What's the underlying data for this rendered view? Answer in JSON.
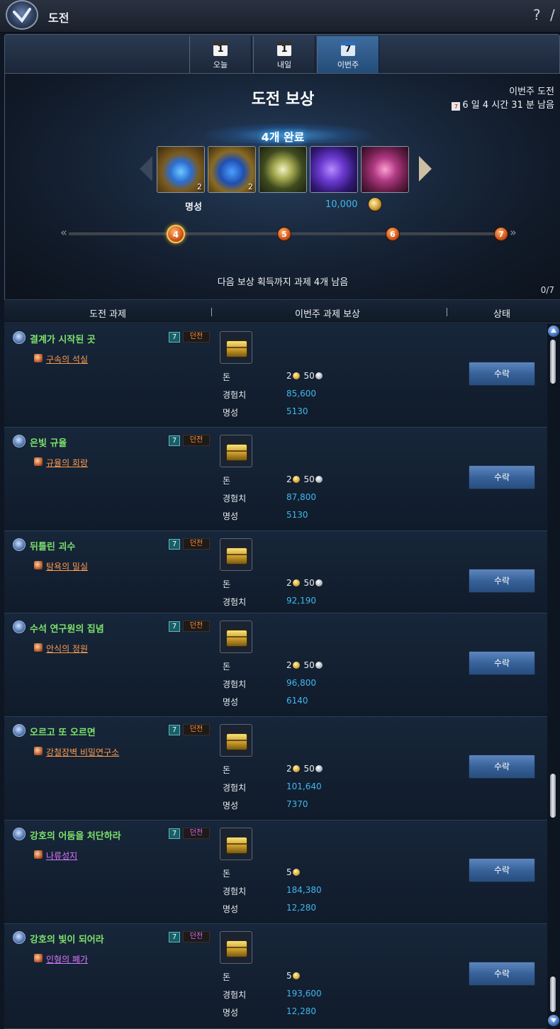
{
  "window": {
    "title": "도전",
    "help": "?",
    "close": "/"
  },
  "tabs": [
    {
      "label": "오늘",
      "cal_number": "1",
      "active": false
    },
    {
      "label": "내일",
      "cal_number": "1",
      "active": false
    },
    {
      "label": "이번주",
      "cal_number": "7",
      "active": true
    }
  ],
  "reward": {
    "title": "도전 보상",
    "week_label": "이번주 도전",
    "time_left": "6 일 4 시간 31 분 남음",
    "complete_label": "4개 완료",
    "icons": [
      {
        "name": "golden-orb-item",
        "qty": "2"
      },
      {
        "name": "blue-orb-item",
        "qty": "2"
      },
      {
        "name": "glowing-sphere-item",
        "qty": ""
      },
      {
        "name": "purple-box-item",
        "qty": ""
      },
      {
        "name": "pink-box-item",
        "qty": ""
      }
    ],
    "fame_label": "명성",
    "money_value": "10,000",
    "progress": {
      "current": "4",
      "nodes": [
        "4",
        "5",
        "6",
        "7"
      ]
    },
    "next_msg": "다음 보상 획득까지 과제 4개 남음",
    "count": "0/7"
  },
  "table": {
    "headers": {
      "task": "도전 과제",
      "reward": "이번주 과제 보상",
      "status": "상태"
    },
    "labels": {
      "money": "돈",
      "exp": "경험치",
      "fame": "명성",
      "level": "7",
      "dungeon": "던전",
      "accept": "수락"
    },
    "rows": [
      {
        "name": "결계가 시작된 곳",
        "location": "구속의 석실",
        "loc_color": "orange",
        "gold": "2",
        "silver": "50",
        "exp": "85,600",
        "fame": "5130"
      },
      {
        "name": "은빛 규율",
        "location": "규율의 회랑",
        "loc_color": "orange",
        "gold": "2",
        "silver": "50",
        "exp": "87,800",
        "fame": "5130"
      },
      {
        "name": "뒤틀린 괴수",
        "location": "탐욕의 밀실",
        "loc_color": "orange",
        "gold": "2",
        "silver": "50",
        "exp": "92,190",
        "fame": ""
      },
      {
        "name": "수석 연구원의 집념",
        "location": "안식의 정원",
        "loc_color": "orange",
        "gold": "2",
        "silver": "50",
        "exp": "96,800",
        "fame": "6140"
      },
      {
        "name": "오르고 또 오르면",
        "location": "강철장벽 비밀연구소",
        "loc_color": "orange",
        "gold": "2",
        "silver": "50",
        "exp": "101,640",
        "fame": "7370"
      },
      {
        "name": "강호의 어둠을 처단하라",
        "location": "나류성지",
        "loc_color": "purple",
        "gold": "5",
        "silver": "",
        "exp": "184,380",
        "fame": "12,280"
      },
      {
        "name": "강호의 빛이 되어라",
        "location": "인형의 폐가",
        "loc_color": "purple",
        "gold": "5",
        "silver": "",
        "exp": "193,600",
        "fame": "12,280"
      }
    ]
  }
}
